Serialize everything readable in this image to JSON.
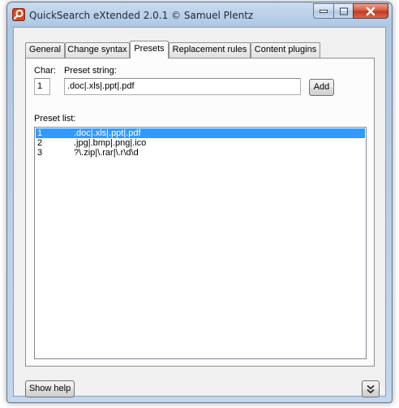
{
  "window": {
    "title": "QuickSearch eXtended 2.0.1 © Samuel Plentz"
  },
  "tabs": [
    "General",
    "Change syntax",
    "Presets",
    "Replacement rules",
    "Content plugins"
  ],
  "form": {
    "char_label": "Char:",
    "char_value": "1",
    "preset_label": "Preset string:",
    "preset_value": ".doc|.xls|.ppt|.pdf",
    "add_label": "Add",
    "list_label": "Preset list:"
  },
  "presets": [
    {
      "num": "1",
      "value": ".doc|.xls|.ppt|.pdf",
      "selected": true
    },
    {
      "num": "2",
      "value": ".jpg|.bmp|.png|.ico",
      "selected": false
    },
    {
      "num": "3",
      "value": "?\\.zip|\\.rar|\\.r\\d\\d",
      "selected": false
    }
  ],
  "footer": {
    "help_label": "Show help",
    "expand_icon": "double-chevron-down-icon"
  },
  "colors": {
    "selection": "#3399ff",
    "close_button": "#c1381d",
    "app_icon": "#d8461c"
  }
}
